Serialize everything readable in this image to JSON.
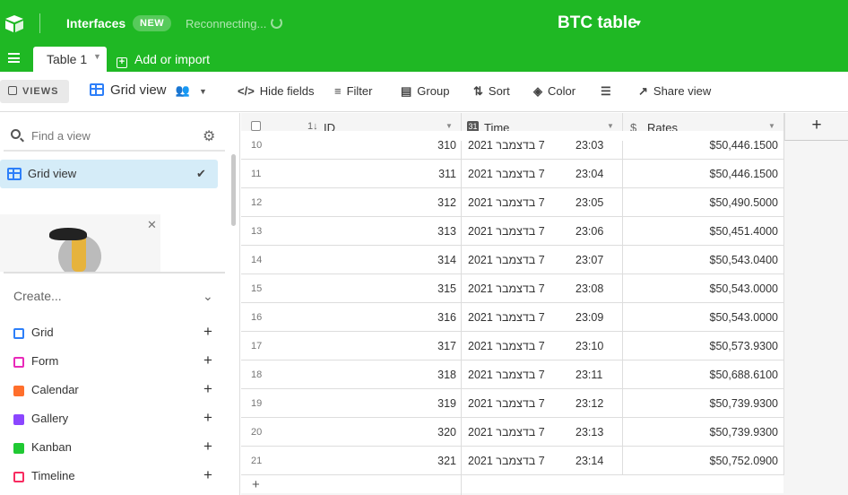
{
  "topbar": {
    "interfaces_label": "Interfaces",
    "new_badge": "NEW",
    "status": "Reconnecting...",
    "base_title": "BTC table",
    "accent_color": "#1fb824"
  },
  "tabs": {
    "active_label": "Table 1",
    "add_import_label": "Add or import"
  },
  "toolbar": {
    "views_label": "VIEWS",
    "view_name": "Grid view",
    "hide_fields": "Hide fields",
    "filter": "Filter",
    "group": "Group",
    "sort": "Sort",
    "color": "Color",
    "share_view": "Share view"
  },
  "sidebar": {
    "find_placeholder": "Find a view",
    "active_view": "Grid view",
    "create_label": "Create...",
    "create_types": [
      {
        "label": "Grid",
        "color": "#2d7ff9"
      },
      {
        "label": "Form",
        "color": "#e929ba"
      },
      {
        "label": "Calendar",
        "color": "#ff6f2c"
      },
      {
        "label": "Gallery",
        "color": "#8b46ff"
      },
      {
        "label": "Kanban",
        "color": "#20c933"
      },
      {
        "label": "Timeline",
        "color": "#f82b60"
      }
    ]
  },
  "grid": {
    "columns": [
      "ID",
      "Time",
      "Rates"
    ],
    "add_column": "+",
    "add_row": "+",
    "rows": [
      {
        "n": "10",
        "id": "310",
        "date": "7 בדצמבר 2021",
        "time": "23:03",
        "rate": "$50,446.1500"
      },
      {
        "n": "11",
        "id": "311",
        "date": "7 בדצמבר 2021",
        "time": "23:04",
        "rate": "$50,446.1500"
      },
      {
        "n": "12",
        "id": "312",
        "date": "7 בדצמבר 2021",
        "time": "23:05",
        "rate": "$50,490.5000"
      },
      {
        "n": "13",
        "id": "313",
        "date": "7 בדצמבר 2021",
        "time": "23:06",
        "rate": "$50,451.4000"
      },
      {
        "n": "14",
        "id": "314",
        "date": "7 בדצמבר 2021",
        "time": "23:07",
        "rate": "$50,543.0400"
      },
      {
        "n": "15",
        "id": "315",
        "date": "7 בדצמבר 2021",
        "time": "23:08",
        "rate": "$50,543.0000"
      },
      {
        "n": "16",
        "id": "316",
        "date": "7 בדצמבר 2021",
        "time": "23:09",
        "rate": "$50,543.0000"
      },
      {
        "n": "17",
        "id": "317",
        "date": "7 בדצמבר 2021",
        "time": "23:10",
        "rate": "$50,573.9300"
      },
      {
        "n": "18",
        "id": "318",
        "date": "7 בדצמבר 2021",
        "time": "23:11",
        "rate": "$50,688.6100"
      },
      {
        "n": "19",
        "id": "319",
        "date": "7 בדצמבר 2021",
        "time": "23:12",
        "rate": "$50,739.9300"
      },
      {
        "n": "20",
        "id": "320",
        "date": "7 בדצמבר 2021",
        "time": "23:13",
        "rate": "$50,739.9300"
      },
      {
        "n": "21",
        "id": "321",
        "date": "7 בדצמבר 2021",
        "time": "23:14",
        "rate": "$50,752.0900"
      }
    ]
  }
}
